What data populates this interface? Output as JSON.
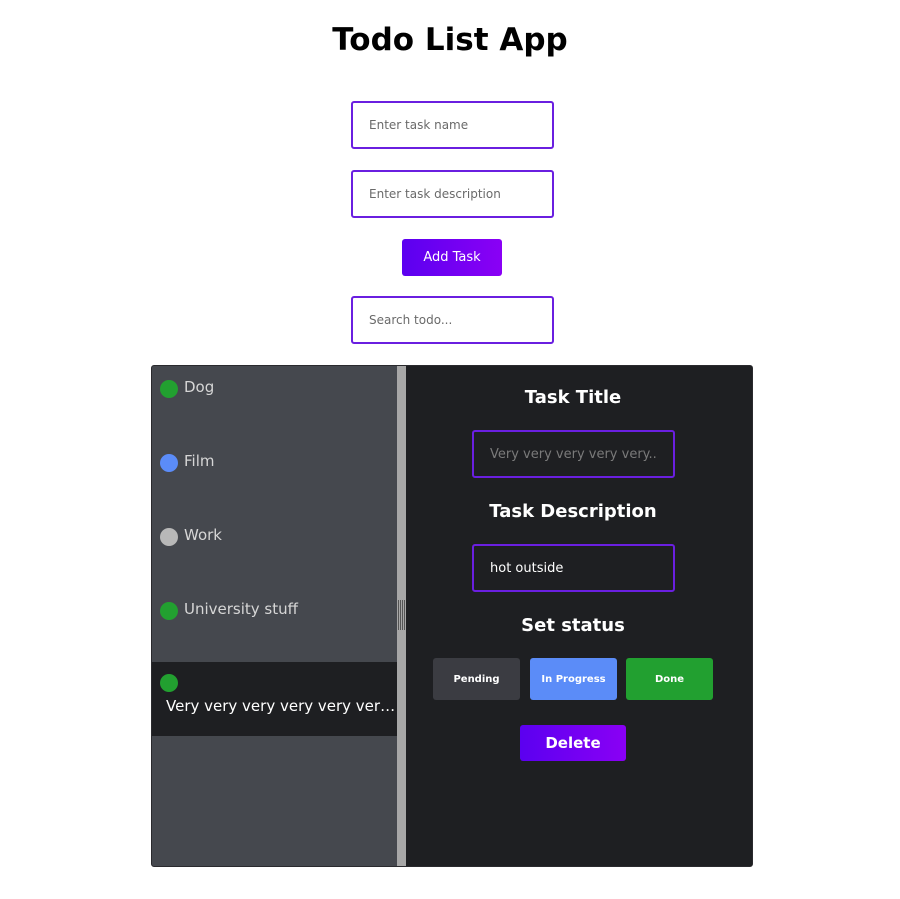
{
  "app": {
    "title": "Todo List App"
  },
  "form": {
    "task_name_placeholder": "Enter task name",
    "task_name_value": "",
    "task_description_placeholder": "Enter task description",
    "task_description_value": "",
    "add_button_label": "Add Task",
    "search_placeholder": "Search todo...",
    "search_value": ""
  },
  "todos": [
    {
      "label": "Dog",
      "status_color": "#22a030",
      "selected": false
    },
    {
      "label": "Film",
      "status_color": "#5b8cf8",
      "selected": false
    },
    {
      "label": "Work",
      "status_color": "#b8b8b8",
      "selected": false
    },
    {
      "label": "University stuff",
      "status_color": "#22a030",
      "selected": false
    },
    {
      "label": "Very very very very very very very...",
      "status_color": "#22a030",
      "selected": true
    }
  ],
  "detail": {
    "title_heading": "Task Title",
    "title_placeholder": "Very very very very very...",
    "title_value": "",
    "description_heading": "Task Description",
    "description_value": "hot outside",
    "status_heading": "Set status",
    "status_buttons": {
      "pending": "Pending",
      "in_progress": "In Progress",
      "done": "Done"
    },
    "delete_label": "Delete"
  },
  "colors": {
    "accent": "#6a1fe0",
    "gradient_start": "#5b00f0",
    "gradient_end": "#8a00f5",
    "list_background": "#45484e",
    "detail_background": "#1e1f22",
    "status_pending": "#3b3c42",
    "status_in_progress": "#5b8cf8",
    "status_done": "#22a030",
    "status_inactive": "#b8b8b8"
  }
}
